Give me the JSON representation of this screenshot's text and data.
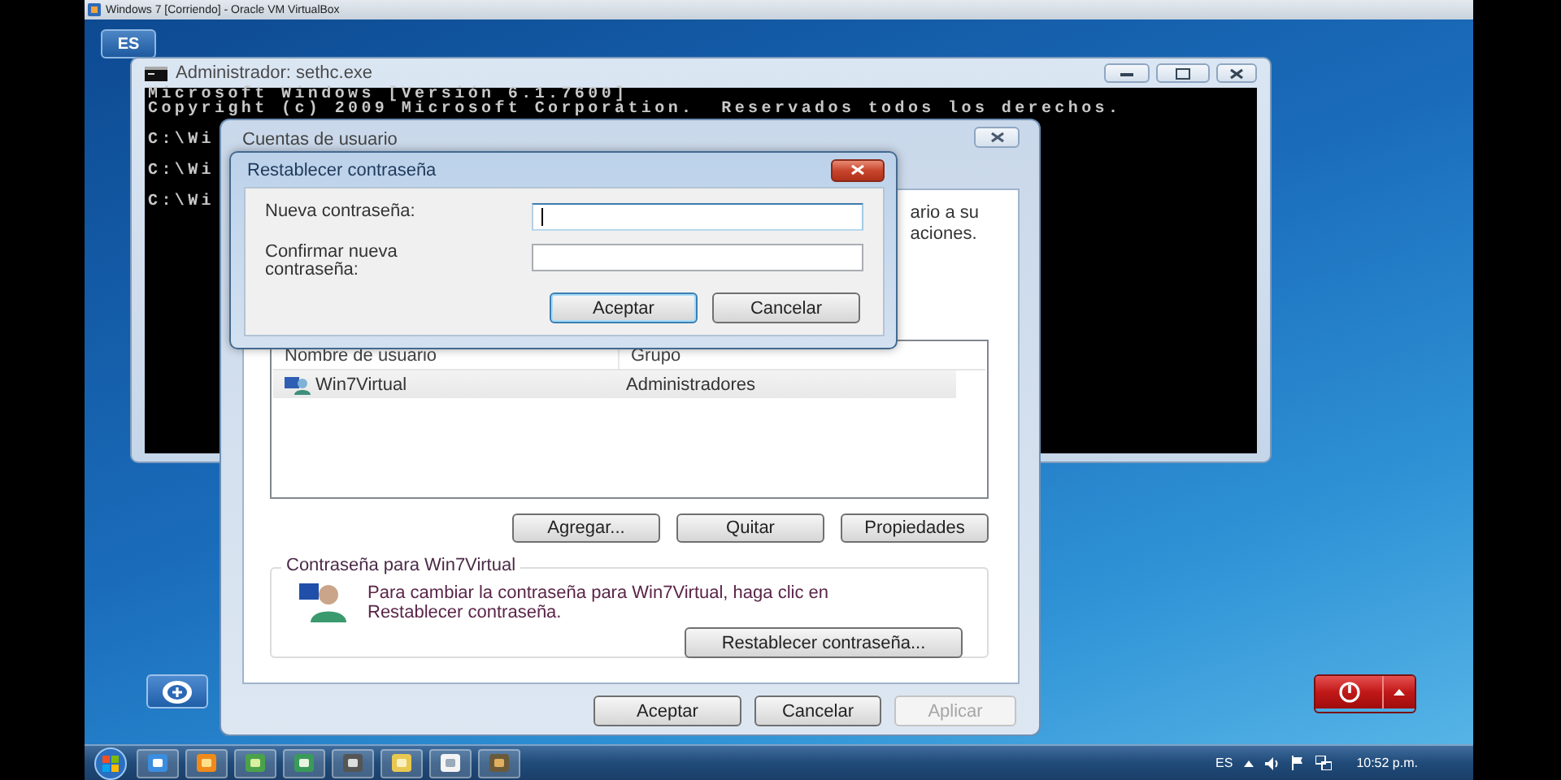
{
  "host_window": {
    "title": "Windows 7 [Corriendo] - Oracle VM VirtualBox"
  },
  "language_badge": "ES",
  "console": {
    "title": "Administrador: sethc.exe",
    "lines": [
      "Microsoft Windows [Versión 6.1.7600]",
      "Copyright (c) 2009 Microsoft Corporation.  Reservados todos los derechos.",
      "C:\\Wi",
      "C:\\Wi",
      "C:\\Wi"
    ]
  },
  "accounts": {
    "title": "Cuentas de usuario",
    "description_lines": [
      "ario a su",
      "aciones."
    ],
    "columns": [
      "Nombre de usuario",
      "Grupo"
    ],
    "rows": [
      {
        "name": "Win7Virtual",
        "group": "Administradores",
        "selected": true
      }
    ],
    "list_buttons": [
      "Agregar...",
      "Quitar",
      "Propiedades"
    ],
    "password_group": {
      "title": "Contraseña para Win7Virtual",
      "text": "Para cambiar la contraseña para Win7Virtual, haga clic en Restablecer contraseña.",
      "button": "Restablecer contraseña..."
    },
    "buttons": [
      {
        "label": "Aceptar",
        "disabled": false
      },
      {
        "label": "Cancelar",
        "disabled": false
      },
      {
        "label": "Aplicar",
        "disabled": true
      }
    ]
  },
  "reset_dialog": {
    "title": "Restablecer contraseña",
    "fields": [
      {
        "label": "Nueva contraseña:",
        "focused": true
      },
      {
        "label": "Confirmar nueva contraseña:",
        "focused": false
      }
    ],
    "buttons": [
      {
        "label": "Aceptar",
        "default": true
      },
      {
        "label": "Cancelar",
        "default": false
      }
    ]
  },
  "taskbar": {
    "language": "ES",
    "clock": "10:52 p.m."
  }
}
